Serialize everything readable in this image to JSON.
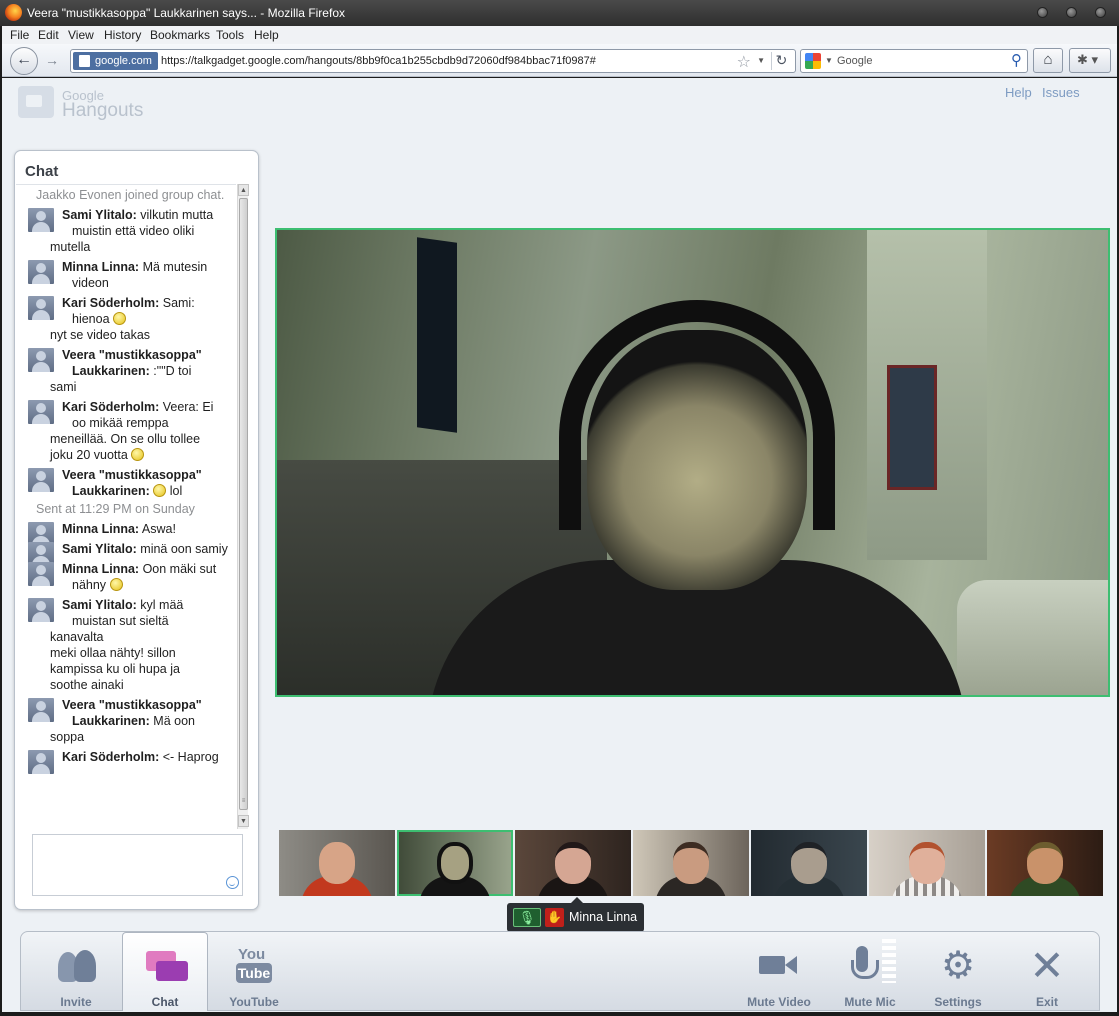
{
  "window": {
    "title": "Veera \"mustikkasoppa\" Laukkarinen says... - Mozilla Firefox"
  },
  "menu": [
    "File",
    "Edit",
    "View",
    "History",
    "Bookmarks",
    "Tools",
    "Help"
  ],
  "navbar": {
    "site_badge": "google.com",
    "url": "https://talkgadget.google.com/hangouts/8bb9f0ca1b255cbdb9d72060df984bbac71f0987#",
    "search_placeholder": "Google"
  },
  "header": {
    "logo_top": "Google",
    "logo_bottom": "Hangouts",
    "help": "Help",
    "issues": "Issues"
  },
  "chat": {
    "title": "Chat",
    "messages": [
      {
        "type": "system",
        "text": "Jaakko Evonen joined group chat."
      },
      {
        "type": "user",
        "sender": "Sami Ylitalo:",
        "text": "vilkutin mutta muistin että video oliki",
        "cont": [
          "mutella"
        ]
      },
      {
        "type": "user",
        "sender": "Minna Linna:",
        "text": "Mä mutesin videon",
        "cont": []
      },
      {
        "type": "user",
        "sender": "Kari Söderholm:",
        "text": "Sami: hienoa",
        "smiley": true,
        "cont": [
          "nyt se video takas"
        ]
      },
      {
        "type": "user",
        "sender": "Veera \"mustikkasoppa\" Laukkarinen:",
        "text": ":\"\"D toi",
        "cont": [
          "sami"
        ]
      },
      {
        "type": "user",
        "sender": "Kari Söderholm:",
        "text": "Veera: Ei oo mikää remppa",
        "cont": [
          "meneillää. On se ollu tollee",
          "joku 20 vuotta"
        ],
        "cont_smiley": true
      },
      {
        "type": "user",
        "sender": "Veera \"mustikkasoppa\" Laukkarinen:",
        "text": "lol",
        "smiley_before": true,
        "cont": []
      },
      {
        "type": "system",
        "text": "Sent at 11:29 PM on Sunday"
      },
      {
        "type": "user",
        "sender": "Minna Linna:",
        "text": "Aswa!",
        "cont": []
      },
      {
        "type": "user",
        "sender": "Sami Ylitalo:",
        "text": "minä oon samiy",
        "cont": []
      },
      {
        "type": "user",
        "sender": "Minna Linna:",
        "text": "Oon mäki sut nähny",
        "smiley": true,
        "cont": []
      },
      {
        "type": "user",
        "sender": "Sami Ylitalo:",
        "text": "kyl mää muistan sut sieltä",
        "cont": [
          "kanavalta",
          "meki ollaa nähty! sillon",
          "kampissa ku oli hupa ja",
          "soothe ainaki"
        ]
      },
      {
        "type": "user",
        "sender": "Veera \"mustikkasoppa\" Laukkarinen:",
        "text": "Mä oon",
        "cont": [
          "soppa"
        ]
      },
      {
        "type": "user",
        "sender": "Kari Söderholm:",
        "text": "<- Haprog",
        "cont": []
      }
    ]
  },
  "tooltip": {
    "name": "Minna Linna"
  },
  "toolbar": {
    "invite": "Invite",
    "chat": "Chat",
    "youtube_you": "You",
    "youtube_tube": "Tube",
    "youtube": "YouTube",
    "mute_video": "Mute Video",
    "mute_mic": "Mute Mic",
    "settings": "Settings",
    "exit": "Exit"
  },
  "colors": {
    "active_border": "#3dbe71",
    "link": "#7d9bc2"
  }
}
